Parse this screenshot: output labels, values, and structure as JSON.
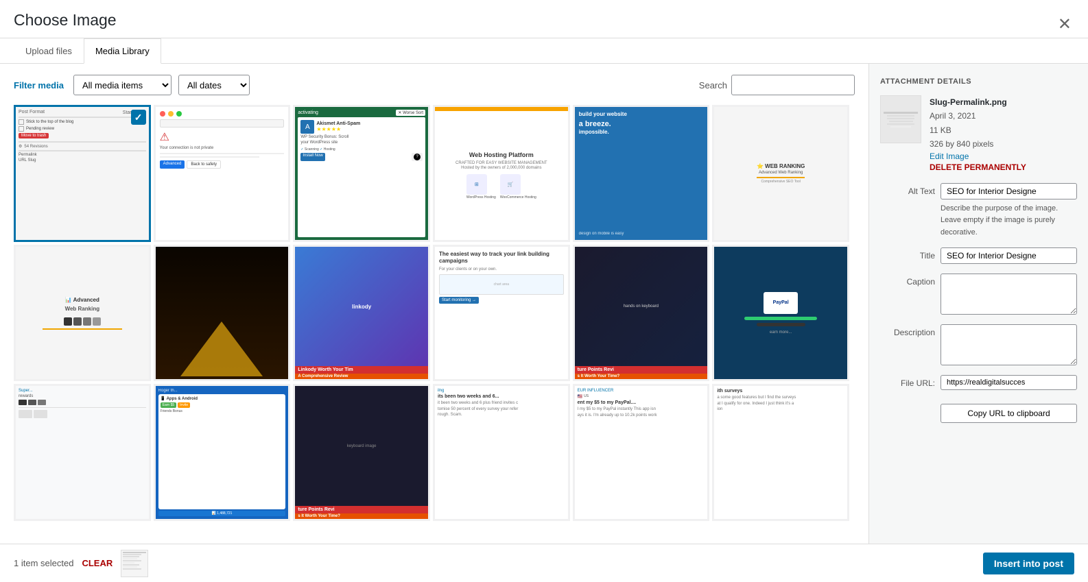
{
  "modal": {
    "title": "Choose Image",
    "close_label": "✕"
  },
  "tabs": [
    {
      "id": "upload",
      "label": "Upload files",
      "active": false
    },
    {
      "id": "library",
      "label": "Media Library",
      "active": true
    }
  ],
  "filter": {
    "label": "Filter media",
    "media_type_label": "All media items",
    "date_label": "All dates",
    "search_label": "Search",
    "search_placeholder": ""
  },
  "attachment_details": {
    "section_title": "ATTACHMENT DETAILS",
    "filename": "Slug-Permalink.png",
    "date": "April 3, 2021",
    "file_size": "11 KB",
    "dimensions": "326 by 840 pixels",
    "edit_label": "Edit Image",
    "delete_label": "DELETE PERMANENTLY",
    "alt_text_label": "Alt Text",
    "alt_text_value": "SEO for Interior Designe",
    "alt_hint_1": "Describe the purpose of the image.",
    "alt_hint_2": " Leave empty if the image is purely decorative.",
    "title_label": "Title",
    "title_value": "SEO for Interior Designe",
    "caption_label": "Caption",
    "caption_value": "",
    "description_label": "Description",
    "description_value": "",
    "file_url_label": "File URL:",
    "file_url_value": "https://realdigitalsucces",
    "copy_url_label": "Copy URL to clipboard"
  },
  "footer": {
    "selected_count": "1 item selected",
    "clear_label": "CLEAR",
    "insert_label": "Insert into post"
  },
  "media_items": [
    {
      "id": 1,
      "type": "slug",
      "selected": true
    },
    {
      "id": 2,
      "type": "browser-warning"
    },
    {
      "id": 3,
      "type": "plugin-card"
    },
    {
      "id": 4,
      "type": "web-hosting"
    },
    {
      "id": 5,
      "type": "blue-website"
    },
    {
      "id": 6,
      "type": "web-ranking"
    },
    {
      "id": 7,
      "type": "awr-logo"
    },
    {
      "id": 8,
      "type": "pyramid"
    },
    {
      "id": 9,
      "type": "linkody"
    },
    {
      "id": 10,
      "type": "link-tracking"
    },
    {
      "id": 11,
      "type": "future-points"
    },
    {
      "id": 12,
      "type": "paypal-card"
    },
    {
      "id": 13,
      "type": "r3-top-blank"
    },
    {
      "id": 14,
      "type": "apps-android"
    },
    {
      "id": 15,
      "type": "future-points-2"
    },
    {
      "id": 16,
      "type": "its-been"
    },
    {
      "id": 17,
      "type": "influencer"
    },
    {
      "id": 18,
      "type": "blank-last"
    }
  ]
}
